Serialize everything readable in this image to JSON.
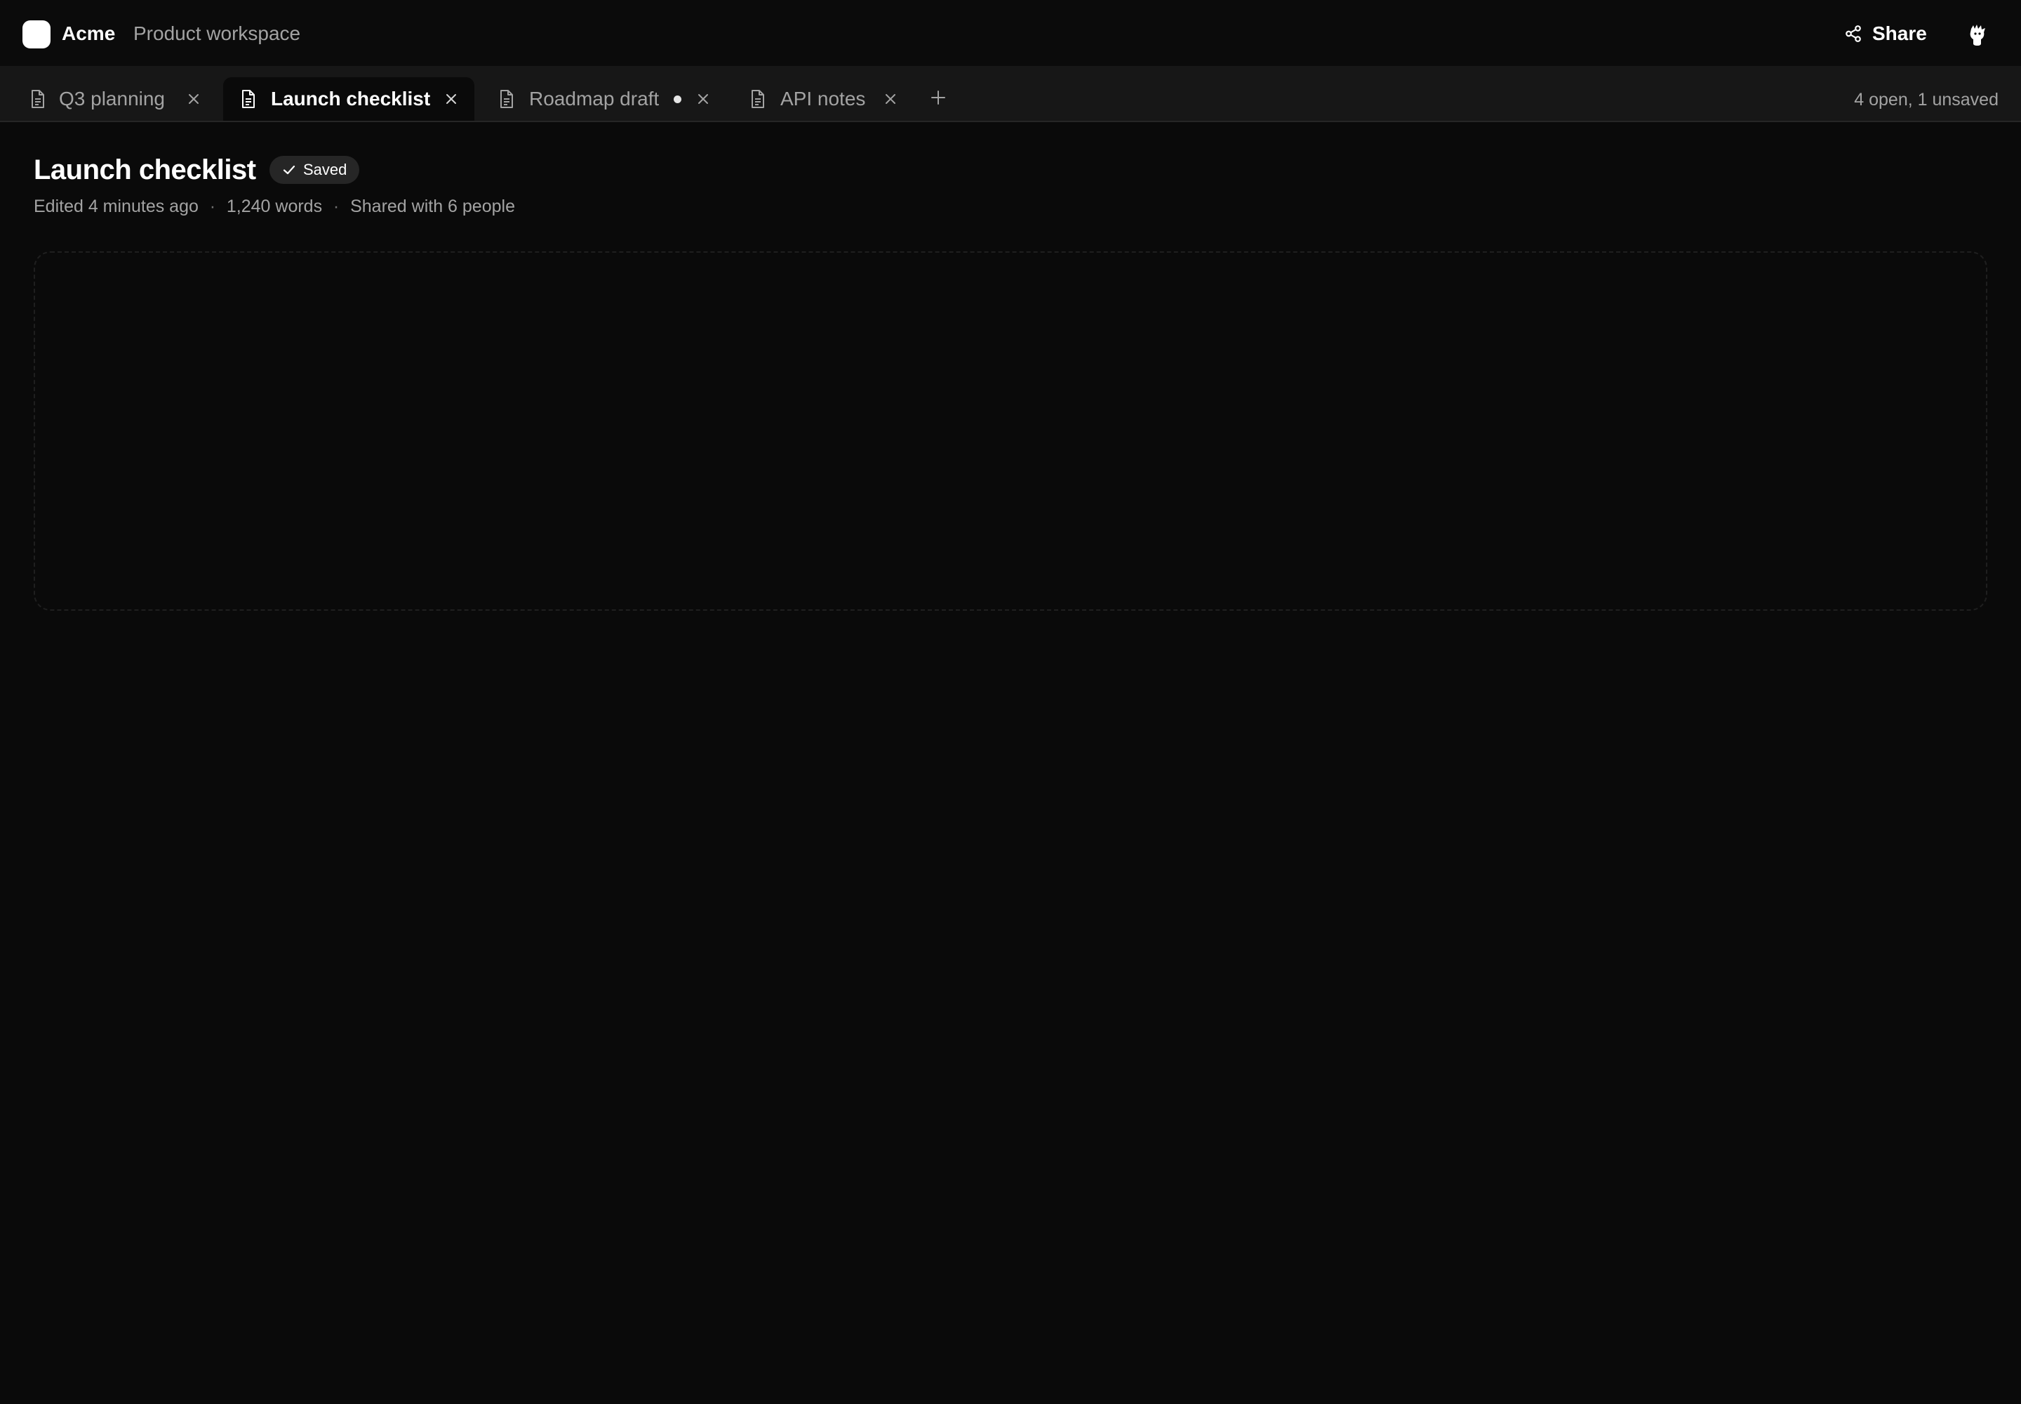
{
  "header": {
    "brand": "Acme",
    "workspace": "Product workspace",
    "share_label": "Share"
  },
  "tabs": [
    {
      "label": "Q3 planning",
      "active": false,
      "unsaved": false
    },
    {
      "label": "Launch checklist",
      "active": true,
      "unsaved": false
    },
    {
      "label": "Roadmap draft",
      "active": false,
      "unsaved": true
    },
    {
      "label": "API notes",
      "active": false,
      "unsaved": false
    }
  ],
  "tab_status": "4 open, 1 unsaved",
  "document": {
    "title": "Launch checklist",
    "status_badge": "Saved",
    "meta": {
      "edited": "Edited 4 minutes ago",
      "words": "1,240 words",
      "shared": "Shared with 6 people",
      "separator": "·"
    }
  },
  "icons": {
    "brand": "logo",
    "share": "share-icon",
    "avatar": "avatar-icon",
    "tab": "document-icon",
    "close": "close-icon",
    "new_tab": "plus-icon",
    "saved": "check-icon"
  },
  "colors": {
    "background": "#0a0a0a",
    "tabstrip": "#171717",
    "text_primary": "#ffffff",
    "text_secondary": "#a3a3a3",
    "badge_bg": "#262626"
  }
}
